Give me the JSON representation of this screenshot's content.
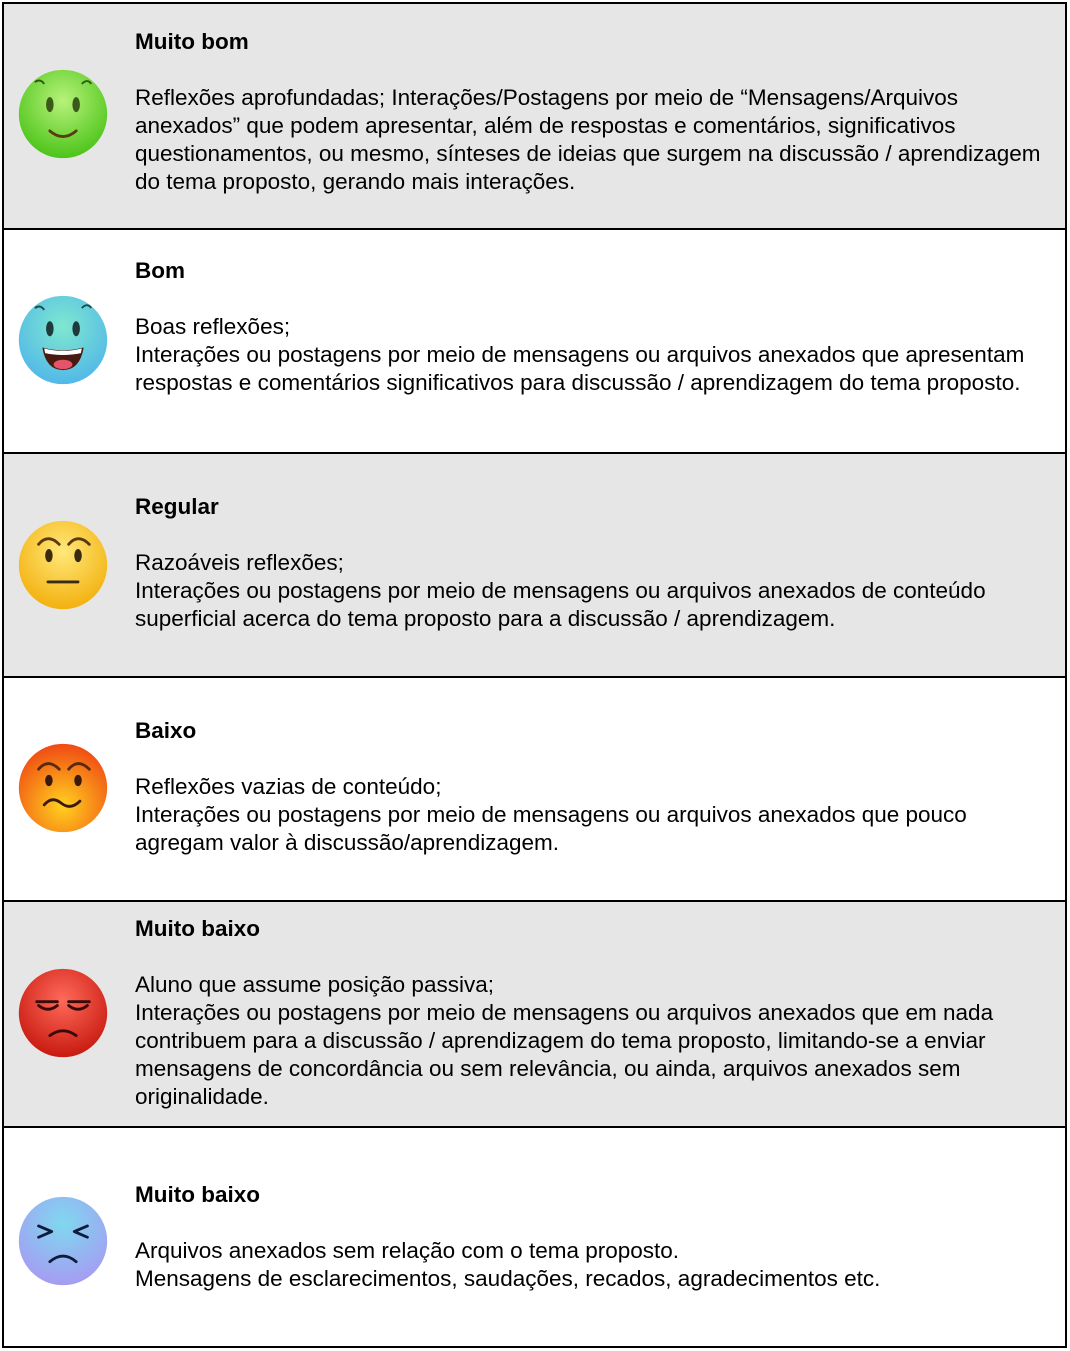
{
  "rows": [
    {
      "title": "Muito bom",
      "lines": [
        "Reflexões aprofundadas; Interações/Postagens por meio de “Mensagens/Arquivos anexados” que podem apresentar, além de respostas e comentários, significativos questionamentos, ou mesmo, sínteses de ideias que surgem na discussão / aprendizagem do tema proposto, gerando mais interações."
      ],
      "icon": "smile-green-icon",
      "color": "#6fdc2a"
    },
    {
      "title": "Bom",
      "lines": [
        "Boas reflexões;",
        "Interações ou postagens por meio de mensagens ou arquivos anexados que apresentam respostas e comentários significativos para discussão / aprendizagem do tema proposto."
      ],
      "icon": "grin-teal-icon",
      "color": "#4ed3b8"
    },
    {
      "title": "Regular",
      "lines": [
        "Razoáveis reflexões;",
        "Interações ou postagens por meio de mensagens ou arquivos anexados de conteúdo superficial acerca do tema proposto para a discussão / aprendizagem."
      ],
      "icon": "neutral-yellow-icon",
      "color": "#f7c51f"
    },
    {
      "title": "Baixo",
      "lines": [
        "Reflexões vazias de conteúdo;",
        "Interações ou postagens por meio de mensagens ou arquivos anexados que pouco agregam valor à discussão/aprendizagem."
      ],
      "icon": "uneasy-orange-icon",
      "color": "#f37a1c"
    },
    {
      "title": "Muito baixo",
      "lines": [
        "Aluno que assume posição passiva;",
        "Interações ou postagens por meio de mensagens ou arquivos anexados que em nada contribuem para a discussão / aprendizagem do tema proposto, limitando-se a enviar mensagens de concordância ou sem relevância, ou ainda, arquivos anexados sem originalidade."
      ],
      "icon": "displeased-red-icon",
      "color": "#e02a1e"
    },
    {
      "title": "Muito baixo",
      "lines": [
        "Arquivos anexados sem relação com o tema proposto.",
        "Mensagens de esclarecimentos, saudações, recados, agradecimentos etc."
      ],
      "icon": "squint-blue-icon",
      "color": "#9aa7f0"
    }
  ]
}
